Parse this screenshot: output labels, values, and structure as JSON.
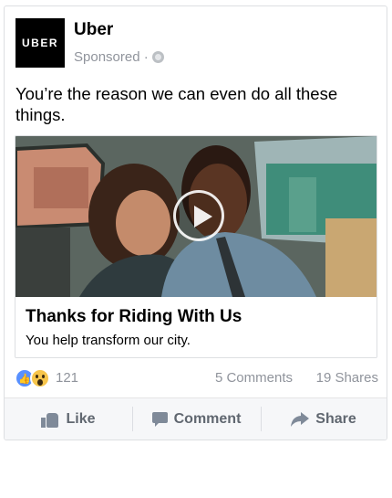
{
  "post": {
    "page_name": "Uber",
    "logo_text": "UBER",
    "sponsored": "Sponsored ·",
    "text": "You’re the reason we can even do all these things.",
    "link": {
      "title": "Thanks for Riding With Us",
      "description": "You help transform our city."
    },
    "reactions": {
      "count": "121",
      "comments": "5 Comments",
      "shares": "19 Shares"
    },
    "actions": {
      "like": "Like",
      "comment": "Comment",
      "share": "Share"
    }
  },
  "colors": {
    "logo_bg": "#000000",
    "like_blue": "#5890ff",
    "wow_yellow": "#f7c54b",
    "muted_text": "#90949c",
    "action_text": "#606770"
  },
  "icons": [
    "globe-icon",
    "play-icon",
    "like-reaction-icon",
    "wow-reaction-icon",
    "thumbs-up-icon",
    "comment-icon",
    "share-icon"
  ]
}
